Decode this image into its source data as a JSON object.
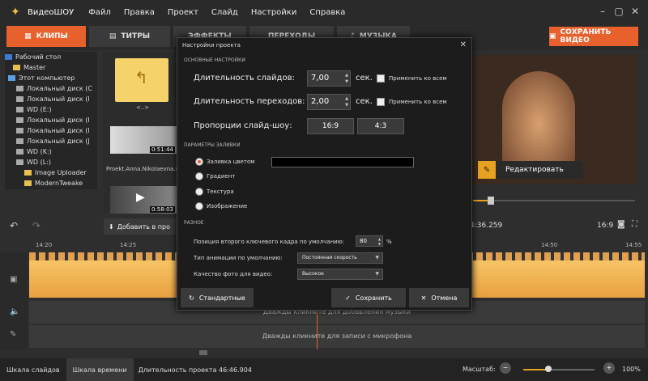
{
  "app": {
    "name": "ВидеоШОУ"
  },
  "menu": [
    "Файл",
    "Правка",
    "Проект",
    "Слайд",
    "Настройки",
    "Справка"
  ],
  "tabs": [
    {
      "label": "КЛИПЫ",
      "icon": "clips-icon"
    },
    {
      "label": "ТИТРЫ",
      "icon": "titles-icon"
    },
    {
      "label": "ЭФФЕКТЫ",
      "icon": "effects-icon"
    },
    {
      "label": "ПЕРЕХОДЫ",
      "icon": "transitions-icon"
    },
    {
      "label": "МУЗЫКА",
      "icon": "music-icon"
    }
  ],
  "save_video": "СОХРАНИТЬ ВИДЕО",
  "tree": [
    "Рабочий стол",
    "Master",
    "Этот компьютер",
    "Локальный диск (C",
    "Локальный диск (I",
    "WD (E:)",
    "Локальный диск (I",
    "Локальный диск (I",
    "Локальный диск (J",
    "WD (K:)",
    "WD (L:)",
    "Image Uploader",
    "ModernTweake"
  ],
  "files": {
    "folder_up": "<..>",
    "thumb1_time": "0:51:44",
    "thumb1_name": "Proekt.Anna.Nikolaevna.s.",
    "thumb2_time": "0:58:03"
  },
  "preview": {
    "edit_label": "Редактировать"
  },
  "timeline": {
    "add_label": "Добавить в про",
    "timecode": "4:36.259",
    "ratio": "16:9",
    "ticks": [
      "14:20",
      "14:25",
      "14:50",
      "14:55"
    ],
    "music_hint": "Дважды кликните для добавления музыки",
    "mic_hint": "Дважды кликните для записи с микрофона"
  },
  "status": {
    "tab_slides": "Шкала слайдов",
    "tab_time": "Шкала времени",
    "duration": "Длительность проекта 46:46.904",
    "zoom_label": "Масштаб:",
    "zoom_value": "100%"
  },
  "dialog": {
    "title": "Настройки проекта",
    "section_main": "ОСНОВНЫЕ НАСТРОЙКИ",
    "slide_duration_label": "Длительность слайдов:",
    "slide_duration_value": "7,00",
    "transition_duration_label": "Длительность переходов:",
    "transition_duration_value": "2,00",
    "sec": "сек.",
    "apply_all": "Применить ко всем",
    "proportions_label": "Пропорции слайд-шоу:",
    "ratio_a": "16:9",
    "ratio_b": "4:3",
    "section_fill": "ПАРАМЕТРЫ ЗАЛИВКИ",
    "fill_options": [
      "Заливка цветом",
      "Градиент",
      "Текстура",
      "Изображение"
    ],
    "fill_color": "#000000",
    "section_misc": "РАЗНОЕ",
    "keyframe_label": "Позиция второго ключевого кадра по умолчанию:",
    "keyframe_value": "80",
    "percent": "%",
    "anim_label": "Тип анимации по умолчанию:",
    "anim_value": "Постоянная скорость",
    "quality_label": "Качество фото для видео:",
    "quality_value": "Высокое",
    "btn_default": "Стандартные",
    "btn_save": "Сохранить",
    "btn_cancel": "Отмена"
  },
  "colors": {
    "accent": "#e8612c",
    "folder": "#f5d26a",
    "track": "#f0b050"
  }
}
